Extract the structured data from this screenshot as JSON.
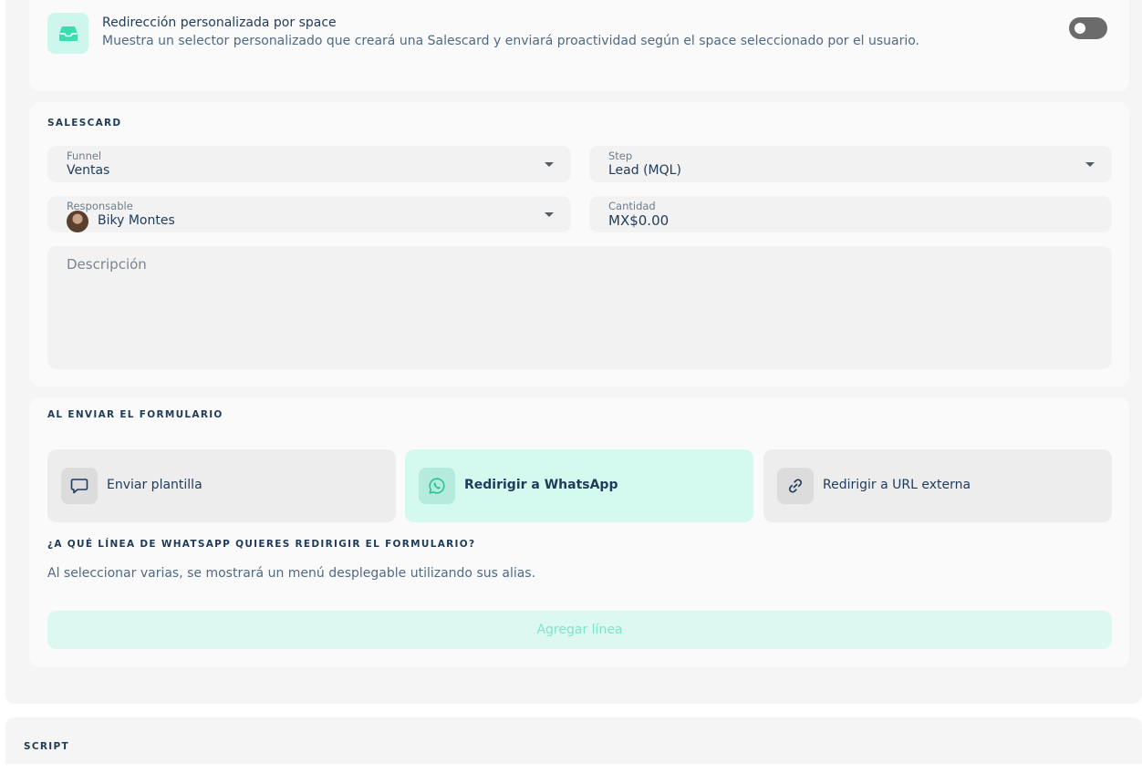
{
  "redirect_space": {
    "title": "Redirección personalizada por space",
    "description": "Muestra un selector personalizado que creará una Salescard y enviará proactividad según el space seleccionado por el usuario.",
    "icon": "inbox-icon",
    "toggle_on": false
  },
  "salescard": {
    "section_title": "SALESCARD",
    "funnel": {
      "label": "Funnel",
      "value": "Ventas"
    },
    "step": {
      "label": "Step",
      "value": "Lead (MQL)"
    },
    "responsable": {
      "label": "Responsable",
      "value": "Biky Montes"
    },
    "cantidad": {
      "label": "Cantidad",
      "value": "MX$0.00"
    },
    "descripcion_placeholder": "Descripción"
  },
  "on_submit": {
    "section_title": "AL ENVIAR EL FORMULARIO",
    "options": [
      {
        "label": "Enviar plantilla",
        "icon": "chat-bubble-icon",
        "selected": false
      },
      {
        "label": "Redirigir a WhatsApp",
        "icon": "whatsapp-icon",
        "selected": true
      },
      {
        "label": "Redirigir a URL externa",
        "icon": "link-icon",
        "selected": false
      }
    ],
    "question_title": "¿A QUÉ LÍNEA DE WHATSAPP QUIERES REDIRIGIR EL FORMULARIO?",
    "question_description": "Al seleccionar varias, se mostrará un menú desplegable utilizando sus alias.",
    "add_line_label": "Agregar línea"
  },
  "script": {
    "section_title": "SCRIPT"
  },
  "colors": {
    "accent": "#3ddbb0",
    "accent_bg": "#d4f9ef",
    "text_primary": "#1f3b5a",
    "toggle_off": "#6b6b6b"
  }
}
